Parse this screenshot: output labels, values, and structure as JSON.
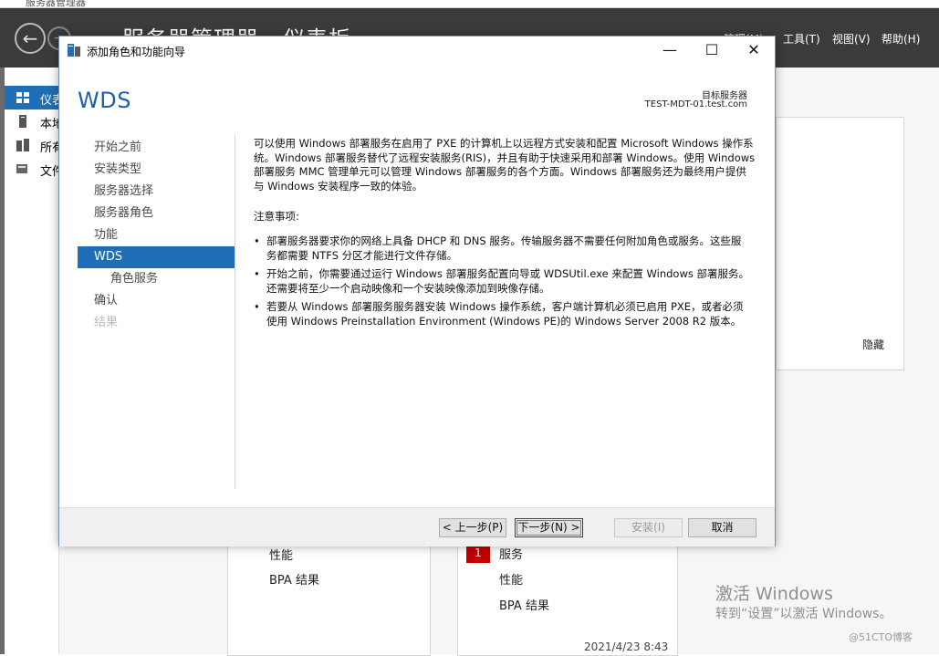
{
  "server_manager": {
    "window_title": "服务器管理器",
    "page_title": "服务器管理器 · 仪表板",
    "menus": [
      "管理(M)",
      "工具(T)",
      "视图(V)",
      "帮助(H)"
    ],
    "sidebar": [
      {
        "label": "仪表板",
        "active": true
      },
      {
        "label": "本地服务器",
        "active": false
      },
      {
        "label": "所有服务器",
        "active": false
      },
      {
        "label": "文件和存储服务",
        "active": false
      }
    ],
    "hide_label": "隐藏",
    "tile_left": {
      "lines": [
        "性能",
        "BPA 结果"
      ]
    },
    "tile_right": {
      "badge": "1",
      "lines": [
        "服务",
        "性能",
        "BPA 结果"
      ]
    },
    "timestamp": "2021/4/23 8:43",
    "activation": {
      "line1": "激活 Windows",
      "line2": "转到“设置”以激活 Windows。"
    },
    "watermark": "@51CTO博客"
  },
  "wizard": {
    "title": "添加角色和功能向导",
    "heading": "WDS",
    "target_label": "目标服务器",
    "target_value": "TEST-MDT-01.test.com",
    "nav": [
      {
        "label": "开始之前",
        "state": "normal",
        "sub": false
      },
      {
        "label": "安装类型",
        "state": "normal",
        "sub": false
      },
      {
        "label": "服务器选择",
        "state": "normal",
        "sub": false
      },
      {
        "label": "服务器角色",
        "state": "normal",
        "sub": false
      },
      {
        "label": "功能",
        "state": "normal",
        "sub": false
      },
      {
        "label": "WDS",
        "state": "active",
        "sub": false
      },
      {
        "label": "角色服务",
        "state": "normal",
        "sub": true
      },
      {
        "label": "确认",
        "state": "normal",
        "sub": false
      },
      {
        "label": "结果",
        "state": "disabled",
        "sub": false
      }
    ],
    "intro": "可以使用 Windows 部署服务在启用了 PXE 的计算机上以远程方式安装和配置 Microsoft Windows 操作系统。Windows 部署服务替代了远程安装服务(RIS)，并且有助于快速采用和部署 Windows。使用 Windows 部署服务 MMC 管理单元可以管理 Windows 部署服务的各个方面。Windows 部署服务还为最终用户提供与 Windows 安装程序一致的体验。",
    "notes_title": "注意事项:",
    "bullets": [
      "部署服务器要求你的网络上具备 DHCP 和 DNS 服务。传输服务器不需要任何附加角色或服务。这些服务都需要 NTFS 分区才能进行文件存储。",
      "开始之前，你需要通过运行 Windows 部署服务配置向导或 WDSUtil.exe 来配置 Windows 部署服务。还需要将至少一个启动映像和一个安装映像添加到映像存储。",
      "若要从 Windows 部署服务服务器安装 Windows 操作系统，客户端计算机必须已启用 PXE，或者必须使用 Windows Preinstallation Environment (Windows PE)的 Windows Server 2008 R2 版本。"
    ],
    "buttons": {
      "prev": "< 上一步(P)",
      "next": "下一步(N) >",
      "install": "安装(I)",
      "cancel": "取消"
    }
  }
}
